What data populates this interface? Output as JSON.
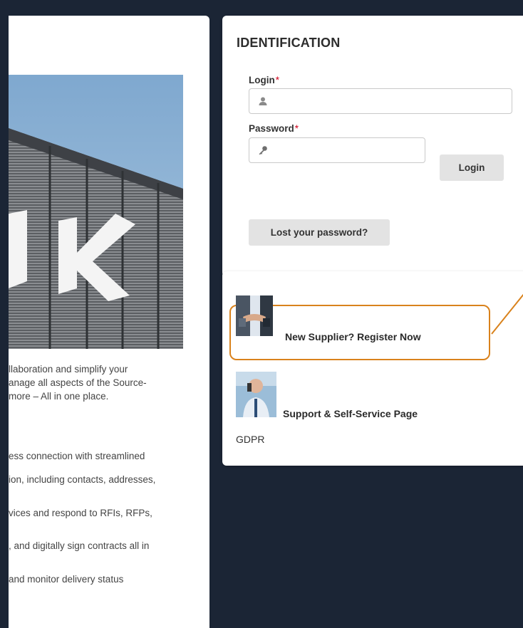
{
  "intro": {
    "lines": [
      "llaboration and simplify your",
      "anage all aspects of the Source-",
      "more – All in one place."
    ]
  },
  "bullets": [
    "ess connection with streamlined",
    "ion, including contacts, addresses,",
    "vices and respond to RFIs, RFPs,",
    ", and digitally sign contracts all in",
    "and monitor delivery status"
  ],
  "identification": {
    "title": "IDENTIFICATION",
    "login_label": "Login",
    "password_label": "Password",
    "required_mark": "*",
    "login_button": "Login",
    "lost_password_button": "Lost your password?"
  },
  "links": {
    "register": "New Supplier? Register Now",
    "support": "Support & Self-Service Page",
    "gdpr": "GDPR"
  },
  "icons": {
    "login_field": "user-icon",
    "password_field": "key-icon"
  },
  "colors": {
    "background": "#1b2535",
    "highlight": "#d9821c",
    "required": "#d0021b",
    "button": "#e3e3e3"
  }
}
